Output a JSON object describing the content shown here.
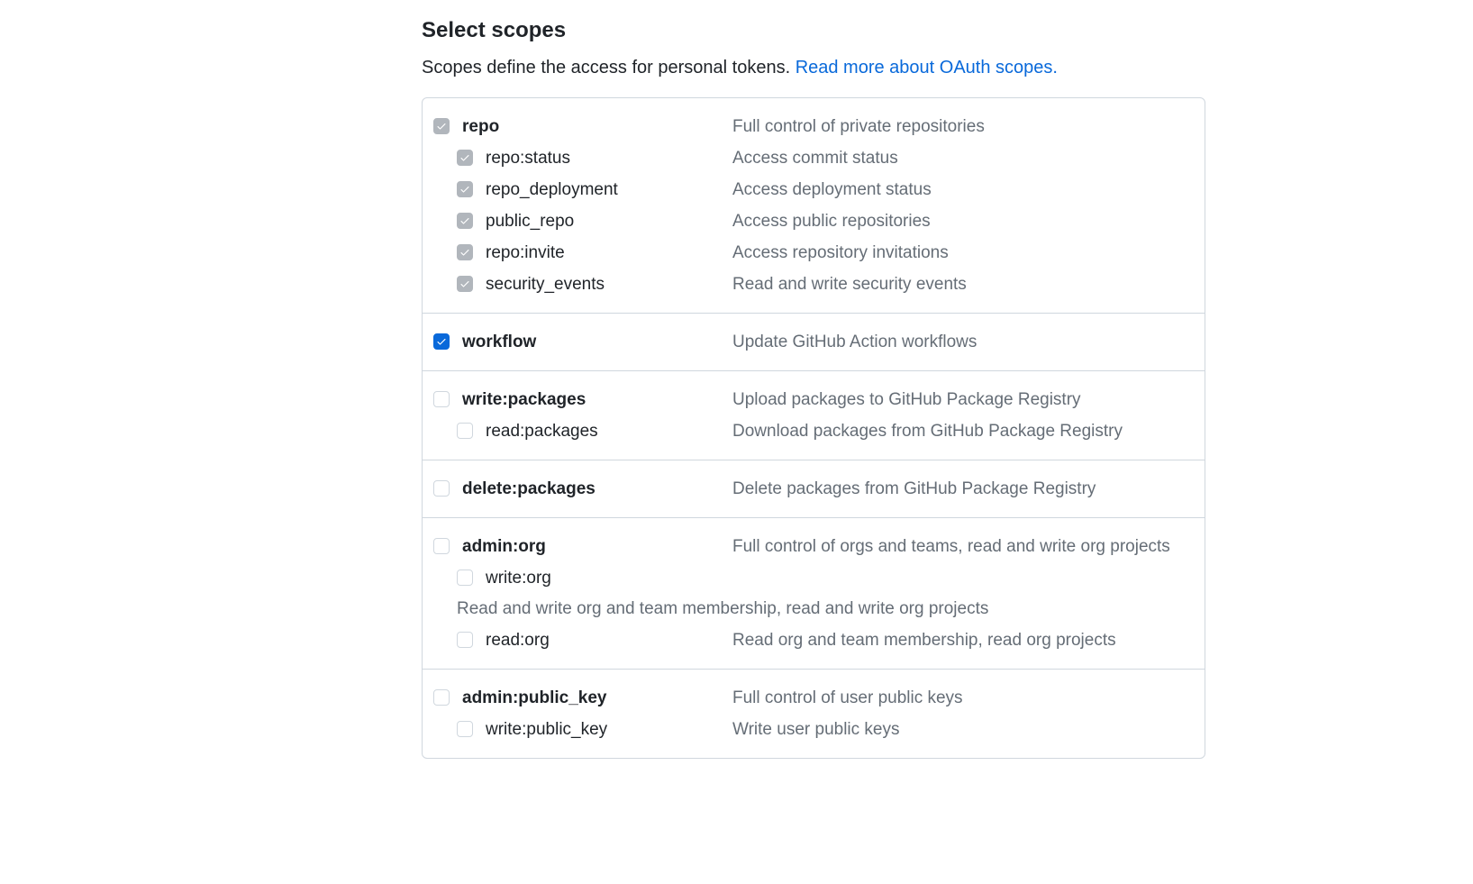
{
  "header": {
    "title": "Select scopes",
    "description_prefix": "Scopes define the access for personal tokens. ",
    "link_text": "Read more about OAuth scopes."
  },
  "groups": [
    {
      "parent": {
        "label": "repo",
        "desc": "Full control of private repositories",
        "state": "disabled-checked"
      },
      "children": [
        {
          "label": "repo:status",
          "desc": "Access commit status",
          "state": "disabled-checked"
        },
        {
          "label": "repo_deployment",
          "desc": "Access deployment status",
          "state": "disabled-checked"
        },
        {
          "label": "public_repo",
          "desc": "Access public repositories",
          "state": "disabled-checked"
        },
        {
          "label": "repo:invite",
          "desc": "Access repository invitations",
          "state": "disabled-checked"
        },
        {
          "label": "security_events",
          "desc": "Read and write security events",
          "state": "disabled-checked"
        }
      ]
    },
    {
      "parent": {
        "label": "workflow",
        "desc": "Update GitHub Action workflows",
        "state": "checked"
      },
      "children": []
    },
    {
      "parent": {
        "label": "write:packages",
        "desc": "Upload packages to GitHub Package Registry",
        "state": "unchecked"
      },
      "children": [
        {
          "label": "read:packages",
          "desc": "Download packages from GitHub Package Registry",
          "state": "unchecked"
        }
      ]
    },
    {
      "parent": {
        "label": "delete:packages",
        "desc": "Delete packages from GitHub Package Registry",
        "state": "unchecked"
      },
      "children": []
    },
    {
      "parent": {
        "label": "admin:org",
        "desc": "Full control of orgs and teams, read and write org projects",
        "state": "unchecked"
      },
      "children": [
        {
          "label": "write:org",
          "desc_below": "Read and write org and team membership, read and write org projects",
          "state": "unchecked"
        },
        {
          "label": "read:org",
          "desc": "Read org and team membership, read org projects",
          "state": "unchecked"
        }
      ]
    },
    {
      "parent": {
        "label": "admin:public_key",
        "desc": "Full control of user public keys",
        "state": "unchecked"
      },
      "children": [
        {
          "label": "write:public_key",
          "desc": "Write user public keys",
          "state": "unchecked"
        }
      ]
    }
  ]
}
